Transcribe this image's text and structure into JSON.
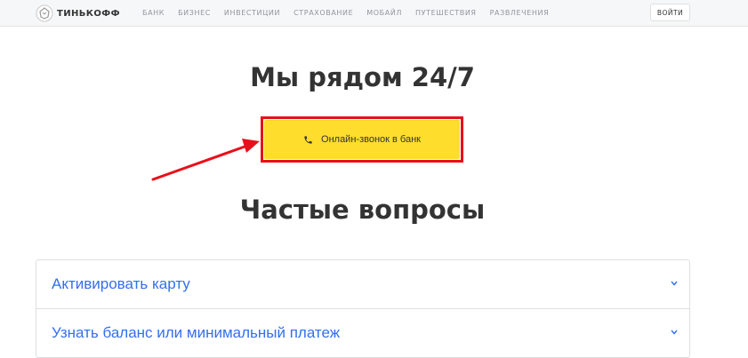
{
  "header": {
    "logo_text": "ТИНЬКОФФ",
    "nav": [
      "БАНК",
      "БИЗНЕС",
      "ИНВЕСТИЦИИ",
      "СТРАХОВАНИЕ",
      "МОБАЙЛ",
      "ПУТЕШЕСТВИЯ",
      "РАЗВЛЕЧЕНИЯ"
    ],
    "login_label": "ВОЙТИ"
  },
  "hero": {
    "title": "Мы рядом 24/7",
    "call_button_label": "Онлайн-звонок в банк"
  },
  "faq": {
    "title": "Частые вопросы",
    "items": [
      {
        "label": "Активировать карту"
      },
      {
        "label": "Узнать баланс или минимальный платеж"
      }
    ]
  },
  "colors": {
    "accent_yellow": "#ffdd2d",
    "highlight_red": "#e8101a",
    "link_blue": "#336fee"
  },
  "icons": {
    "logo": "tinkoff-logo-icon",
    "call": "phone-icon",
    "faq_expand": "chevron-down-icon",
    "annotation": "red-arrow-icon"
  }
}
